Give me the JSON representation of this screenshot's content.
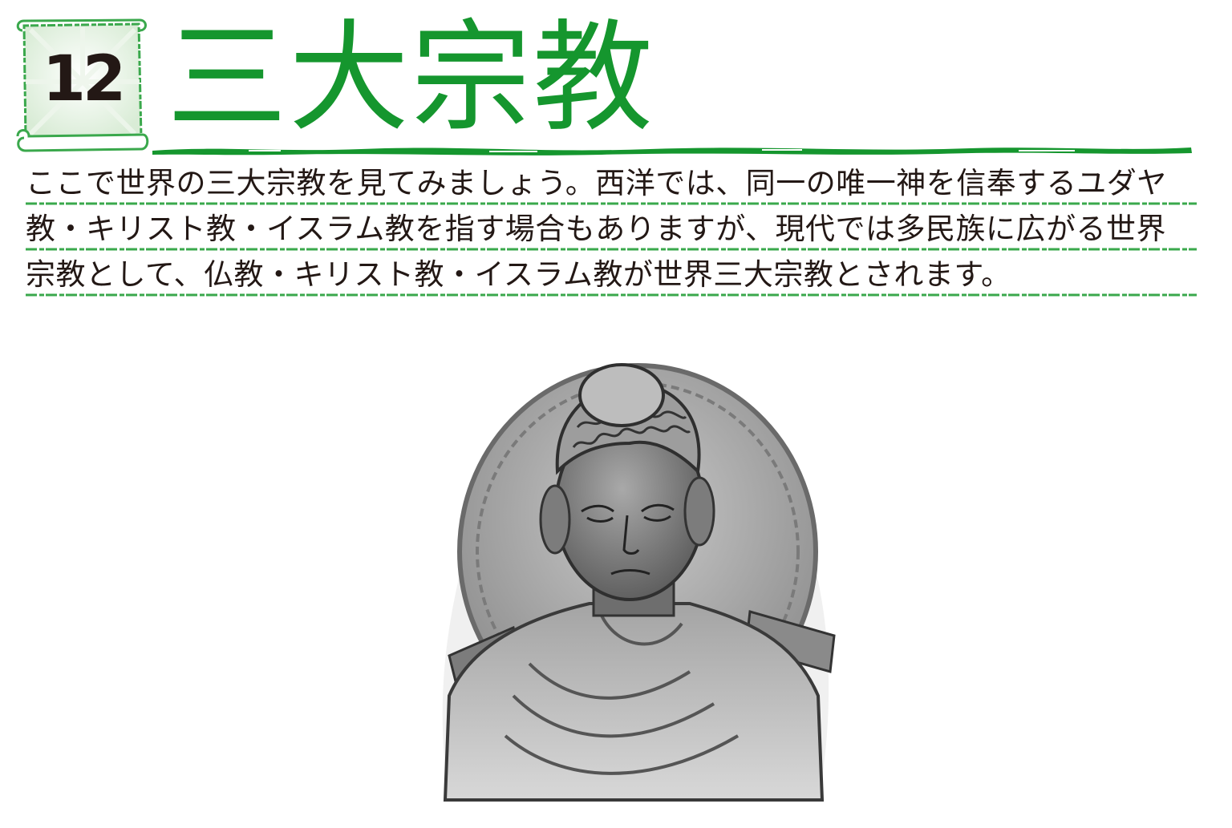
{
  "header": {
    "chapter_number": "12",
    "title": "三大宗教"
  },
  "body": {
    "lines": [
      "ここで世界の三大宗教を見てみましょう。西洋では、同一の唯一神を信奉するユダヤ",
      "教・キリスト教・イスラム教を指す場合もありますが、現代では多民族に広がる世界",
      "宗教として、仏教・キリスト教・イスラム教が世界三大宗教とされます。"
    ]
  },
  "illustration": {
    "subject": "buddha-statue-relief"
  },
  "colors": {
    "accent_green": "#15962e",
    "text": "#231815",
    "badge_bg": "#e9f3e6"
  }
}
